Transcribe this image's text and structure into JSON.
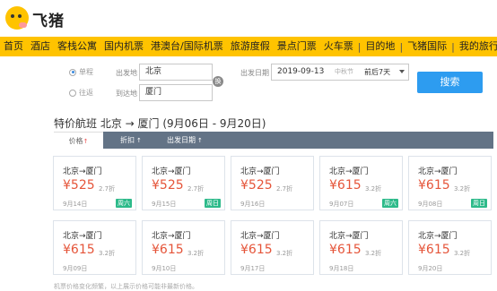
{
  "logo": {
    "text": "飞猪"
  },
  "nav": {
    "items": [
      "首页",
      "酒店",
      "客栈公寓",
      "国内机票",
      "港澳台/国际机票",
      "旅游度假",
      "景点门票",
      "火车票",
      "目的地",
      "飞猪国际",
      "我的旅行"
    ]
  },
  "search": {
    "trip_type_oneway": "单程",
    "trip_type_roundtrip": "往返",
    "from_label": "出发地",
    "from_value": "北京",
    "to_label": "到达地",
    "to_value": "厦门",
    "swap_label": "换",
    "date_label": "出发日期",
    "date_value": "2019-09-13",
    "date_hint": "中秋节",
    "date_range": "前后7天",
    "button_label": "搜索"
  },
  "section": {
    "title": "特价航班 北京 → 厦门  (9月06日 - 9月20日)"
  },
  "sort": {
    "price_label": "价格",
    "price_arrow": "↑",
    "discount_label": "折扣",
    "discount_arrow": "↑",
    "date_label": "出发日期",
    "date_arrow": "↑"
  },
  "cards": [
    {
      "route": "北京→厦门",
      "price": "¥525",
      "discount": "2.7折",
      "date": "9月14日",
      "tag": "周六"
    },
    {
      "route": "北京→厦门",
      "price": "¥525",
      "discount": "2.7折",
      "date": "9月15日",
      "tag": "周日"
    },
    {
      "route": "北京→厦门",
      "price": "¥525",
      "discount": "2.7折",
      "date": "9月16日",
      "tag": ""
    },
    {
      "route": "北京→厦门",
      "price": "¥615",
      "discount": "3.2折",
      "date": "9月07日",
      "tag": "周六"
    },
    {
      "route": "北京→厦门",
      "price": "¥615",
      "discount": "3.2折",
      "date": "9月08日",
      "tag": "周日"
    },
    {
      "route": "北京→厦门",
      "price": "¥615",
      "discount": "3.2折",
      "date": "9月09日",
      "tag": ""
    },
    {
      "route": "北京→厦门",
      "price": "¥615",
      "discount": "3.2折",
      "date": "9月10日",
      "tag": ""
    },
    {
      "route": "北京→厦门",
      "price": "¥615",
      "discount": "3.2折",
      "date": "9月17日",
      "tag": ""
    },
    {
      "route": "北京→厦门",
      "price": "¥615",
      "discount": "3.2折",
      "date": "9月18日",
      "tag": ""
    },
    {
      "route": "北京→厦门",
      "price": "¥615",
      "discount": "3.2折",
      "date": "9月20日",
      "tag": ""
    }
  ],
  "footnote": "机票价格变化频繁，以上展示价格可能非最新价格。",
  "colors": {
    "brand": "#ffc300",
    "accent": "#2d9cf0",
    "price": "#e5553a",
    "tag": "#2dba8a",
    "sortbar": "#637386"
  }
}
